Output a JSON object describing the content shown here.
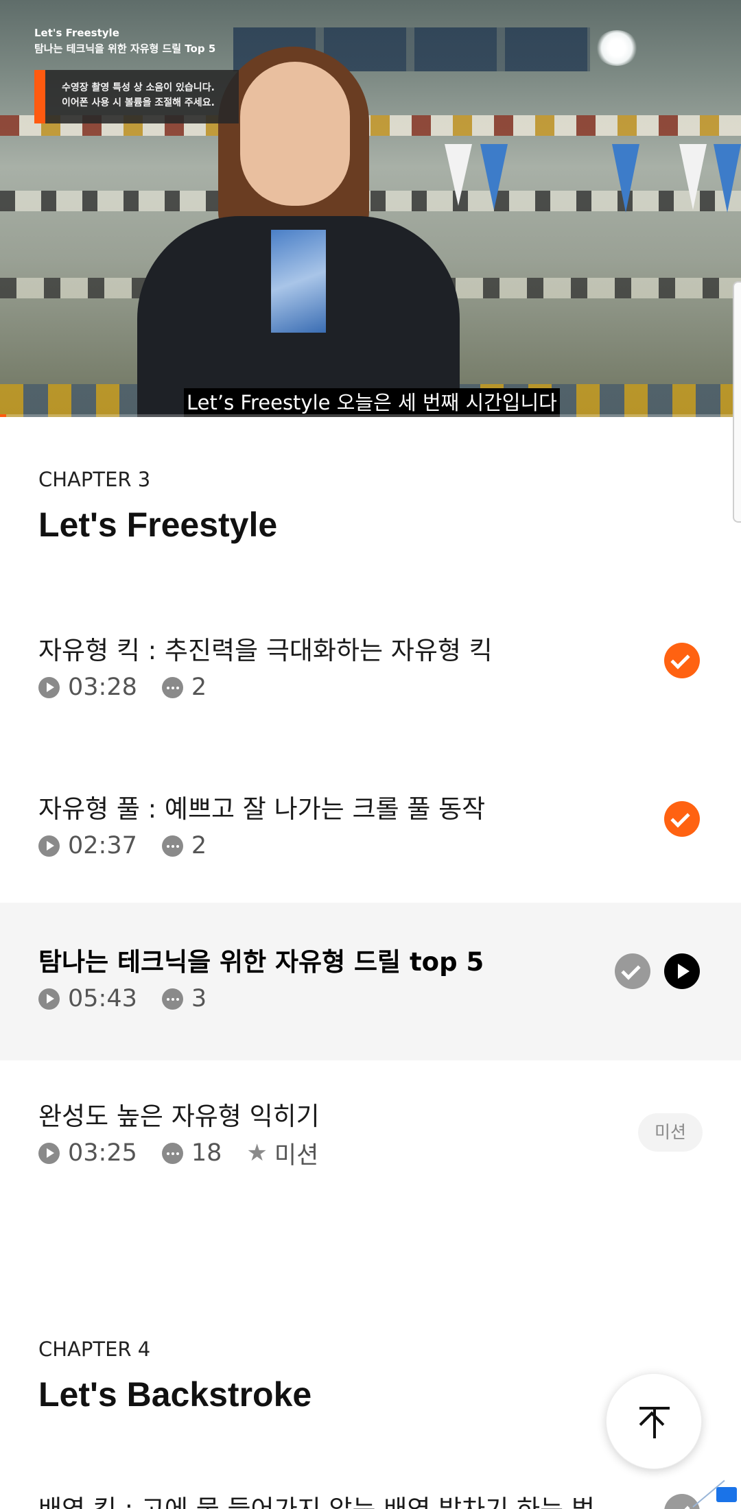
{
  "video": {
    "overlay_title": "Let's Freestyle",
    "overlay_subtitle": "탐나는 테크닉을 위한 자유형 드릴 Top 5",
    "notice_line1": "수영장 촬영 특성 상 소음이 있습니다.",
    "notice_line2": "이어폰 사용 시 볼륨을 조절해 주세요.",
    "caption": "Let’s Freestyle 오늘은 세 번째 시간입니다",
    "progress_fraction": 0.008,
    "accent_color": "#ff5a10"
  },
  "chapter3": {
    "label": "CHAPTER 3",
    "title": "Let's Freestyle",
    "lessons": [
      {
        "title": "자유형 킥 : 추진력을 극대화하는 자유형 킥",
        "duration": "03:28",
        "comments": "2",
        "status": "completed"
      },
      {
        "title": "자유형 풀 : 예쁘고 잘 나가는 크롤 풀 동작",
        "duration": "02:37",
        "comments": "2",
        "status": "completed"
      },
      {
        "title": "탐나는 테크닉을 위한 자유형 드릴 top 5",
        "duration": "05:43",
        "comments": "3",
        "status": "now-playing"
      },
      {
        "title": "완성도 높은 자유형 익히기",
        "duration": "03:25",
        "comments": "18",
        "mission_label": "미션",
        "badge": "미션",
        "status": "mission"
      }
    ]
  },
  "chapter4": {
    "label": "CHAPTER 4",
    "title": "Let's Backstroke",
    "first_lesson_title": "배영 킥 : 고에 물 들어가지 않는 배영 발차기 하는 법"
  },
  "icons": {
    "completed": "check-circle-icon",
    "viewed": "check-circle-gray-icon",
    "play": "play-circle-icon",
    "duration": "play-small-icon",
    "comments": "comment-dots-icon",
    "mission": "star-icon",
    "scroll_top": "arrow-up-to-top-icon"
  }
}
